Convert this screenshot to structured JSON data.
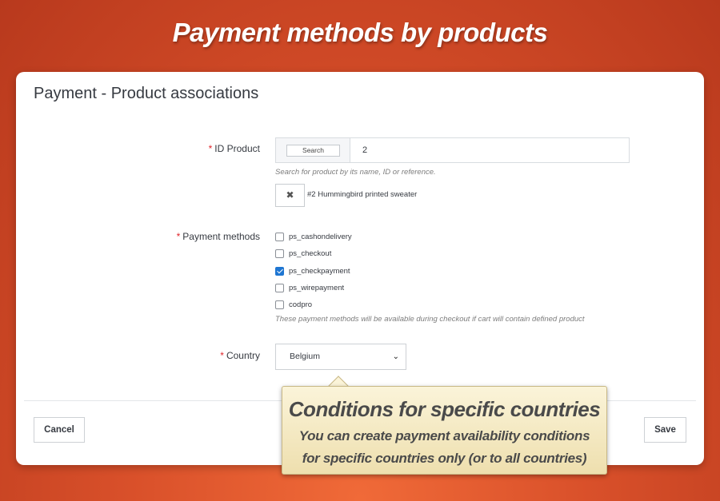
{
  "banner": {
    "title": "Payment methods by products"
  },
  "panel": {
    "title": "Payment - Product associations"
  },
  "id_product": {
    "required_mark": "*",
    "label": "ID Product",
    "search_button": "Search",
    "value": "2",
    "help": "Search for product by its name, ID or reference.",
    "remove_icon": "✖",
    "selected_product": "#2 Hummingbird printed sweater"
  },
  "payment_methods": {
    "required_mark": "*",
    "label": "Payment methods",
    "options": [
      {
        "label": "ps_cashondelivery",
        "checked": false
      },
      {
        "label": "ps_checkout",
        "checked": false
      },
      {
        "label": "ps_checkpayment",
        "checked": true
      },
      {
        "label": "ps_wirepayment",
        "checked": false
      },
      {
        "label": "codpro",
        "checked": false
      }
    ],
    "help": "These payment methods will be available during checkout if cart will contain defined product"
  },
  "country": {
    "required_mark": "*",
    "label": "Country",
    "selected": "Belgium",
    "arrow_icon": "⌄"
  },
  "footer": {
    "cancel_label": "Cancel",
    "save_label": "Save"
  },
  "callout": {
    "title": "Conditions for specific countries",
    "body": "You can create payment availability conditions for specific countries only (or to all countries)"
  },
  "colors": {
    "accent": "#1f76d2",
    "background": "#d9502a",
    "required": "#e0242a"
  }
}
